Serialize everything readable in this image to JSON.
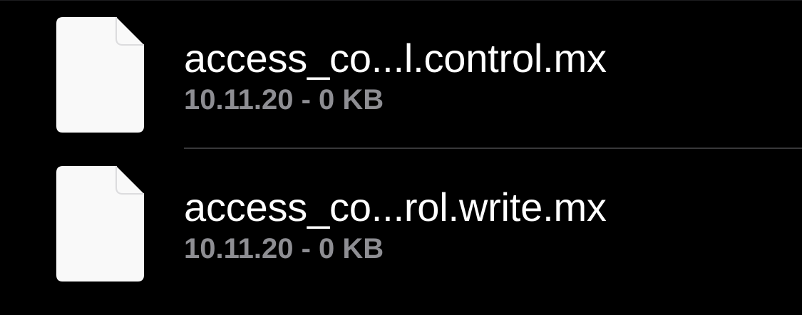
{
  "colors": {
    "background": "#000000",
    "file_name": "#ffffff",
    "file_meta": "#8e8e93",
    "file_icon": "#f9f9f9",
    "separator": "#38383a"
  },
  "files": [
    {
      "icon": "document-icon",
      "name": "access_co...l.control.mx",
      "meta": "10.11.20 - 0 KB"
    },
    {
      "icon": "document-icon",
      "name": "access_co...rol.write.mx",
      "meta": "10.11.20 - 0 KB"
    }
  ]
}
